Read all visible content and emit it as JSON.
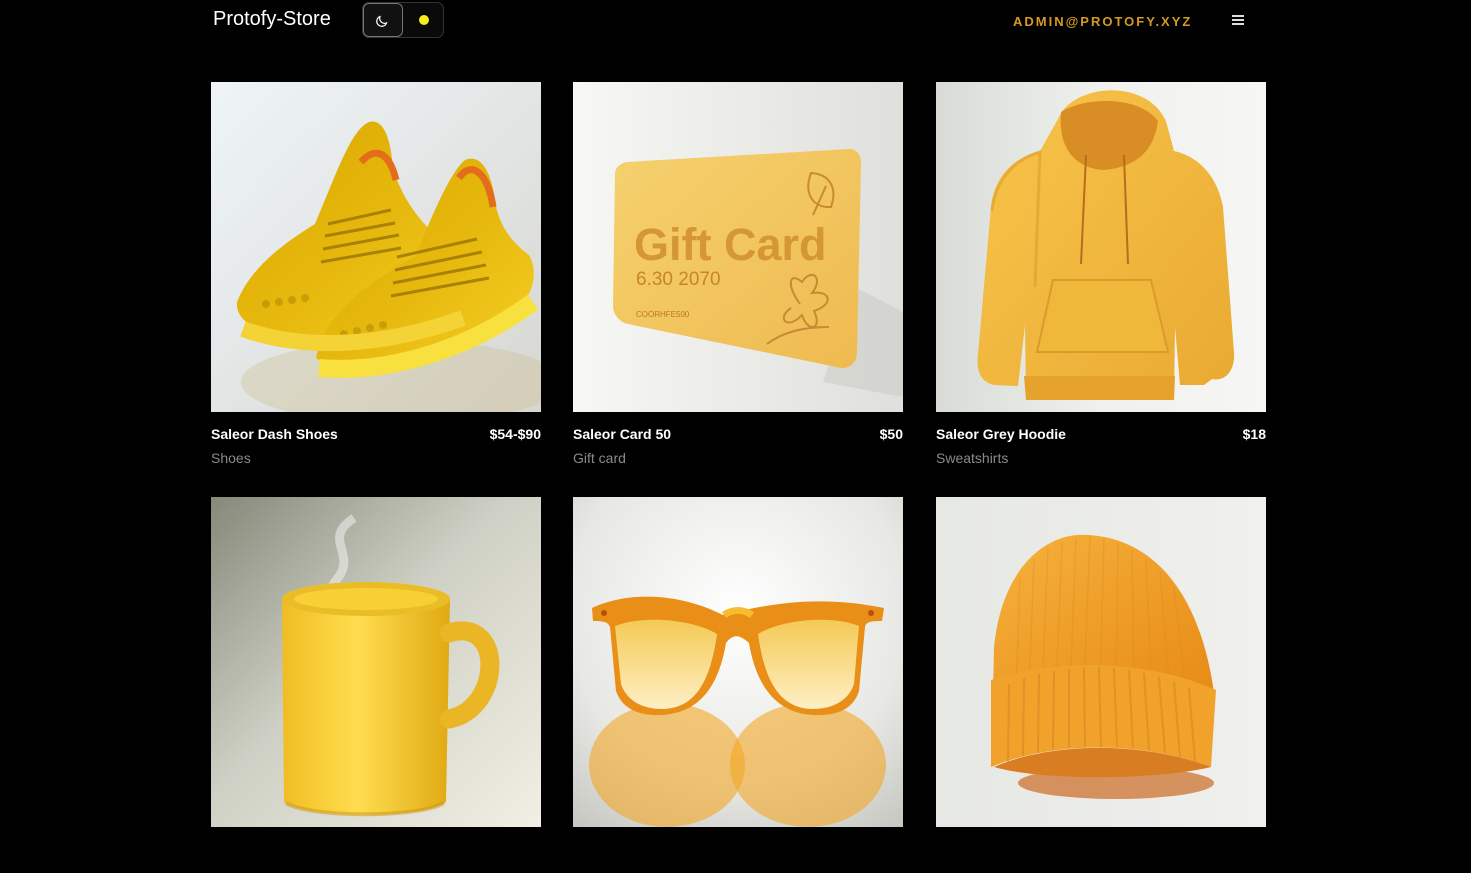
{
  "header": {
    "brand": "Protofy-Store",
    "user": "ADMIN@PROTOFY.XYZ"
  },
  "colors": {
    "background": "#000000",
    "accent": "#d49a21",
    "theme_dot": "#f7ef1b"
  },
  "icons": {
    "theme_dark": "moon-icon",
    "theme_color": "yellow-dot-icon",
    "menu": "hamburger-menu-icon"
  },
  "products": [
    {
      "name": "Saleor Dash Shoes",
      "price": "$54-$90",
      "category": "Shoes",
      "image": "yellow-sneakers"
    },
    {
      "name": "Saleor Card 50",
      "price": "$50",
      "category": "Gift card",
      "image": "gift-card"
    },
    {
      "name": "Saleor Grey Hoodie",
      "price": "$18",
      "category": "Sweatshirts",
      "image": "yellow-hoodie"
    },
    {
      "name": "",
      "price": "",
      "category": "",
      "image": "yellow-mug"
    },
    {
      "name": "",
      "price": "",
      "category": "",
      "image": "yellow-sunglasses"
    },
    {
      "name": "",
      "price": "",
      "category": "",
      "image": "orange-beanie"
    }
  ],
  "gift_card": {
    "title": "Gift Card",
    "numbers": "6.30    2070",
    "code": "COORHFE500"
  }
}
